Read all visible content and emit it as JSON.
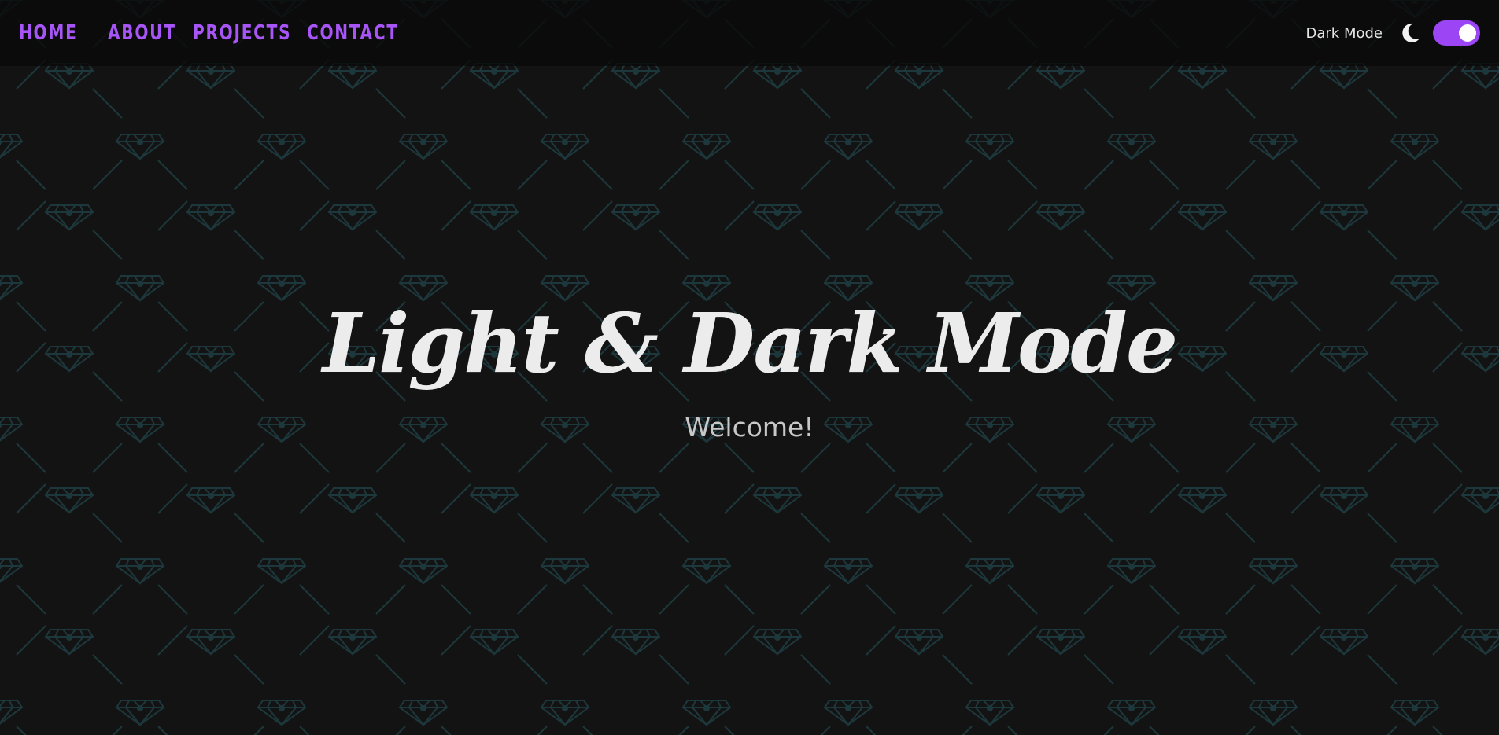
{
  "nav": {
    "links": [
      {
        "label": "HOME"
      },
      {
        "label": "ABOUT"
      },
      {
        "label": "PROJECTS"
      },
      {
        "label": "CONTACT"
      }
    ]
  },
  "theme_switch": {
    "label": "Dark Mode",
    "icon": "moon-icon",
    "enabled": true
  },
  "hero": {
    "title": "Light & Dark Mode",
    "subtitle": "Welcome!"
  },
  "colors": {
    "accent": "#a855f7",
    "background": "#131313",
    "pattern": "#1f3b3f",
    "text": "#ececec"
  }
}
